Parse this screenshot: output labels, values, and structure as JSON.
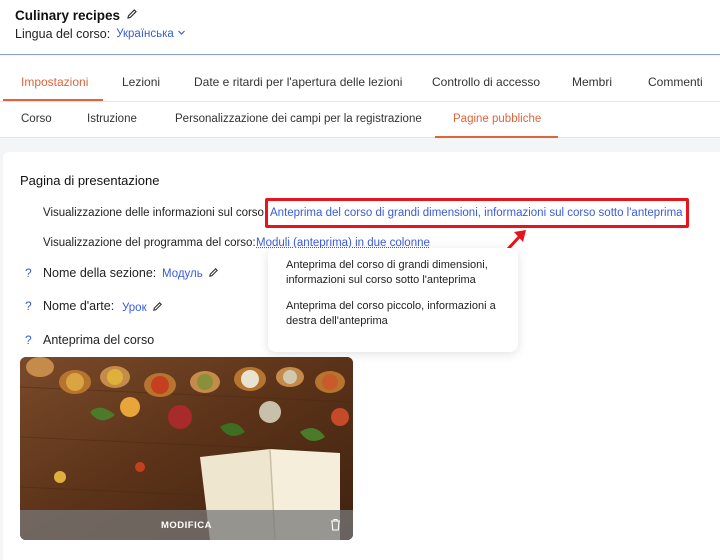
{
  "header": {
    "course_title": "Culinary recipes",
    "lang_label": "Lingua del corso:",
    "lang_value": "Українська"
  },
  "tabs": [
    {
      "label": "Impostazioni",
      "active": true
    },
    {
      "label": "Lezioni"
    },
    {
      "label": "Date e ritardi per l'apertura delle lezioni"
    },
    {
      "label": "Controllo di accesso"
    },
    {
      "label": "Membri"
    },
    {
      "label": "Commenti"
    }
  ],
  "subtabs": [
    {
      "label": "Corso"
    },
    {
      "label": "Istruzione"
    },
    {
      "label": "Personalizzazione dei campi per la registrazione"
    },
    {
      "label": "Pagine pubbliche",
      "active": true
    }
  ],
  "section": {
    "title": "Pagina di presentazione",
    "info_label": "Visualizzazione delle informazioni sul corso:",
    "info_value": "Anteprima del corso di grandi dimensioni, informazioni sul corso sotto l'anteprima",
    "program_label": "Visualizzazione del programma del corso:",
    "program_value": "Moduli (anteprima) in due colonne",
    "section_name_label": "Nome della sezione:",
    "section_name_value": "Модуль",
    "stage_name_label": "Nome d'arte:",
    "stage_name_value": "Урок",
    "preview_label": "Anteprima del corso",
    "help_mark": "?"
  },
  "dropdown": {
    "options": [
      "Anteprima del corso di grandi dimensioni, informazioni sul corso sotto l'anteprima",
      "Anteprima del corso piccolo, informazioni a destra dell'anteprima"
    ]
  },
  "image_card": {
    "modify_label": "MODIFICA"
  },
  "colors": {
    "accent": "#e0643a",
    "link": "#3a5bd9",
    "highlight": "#e8141b"
  }
}
